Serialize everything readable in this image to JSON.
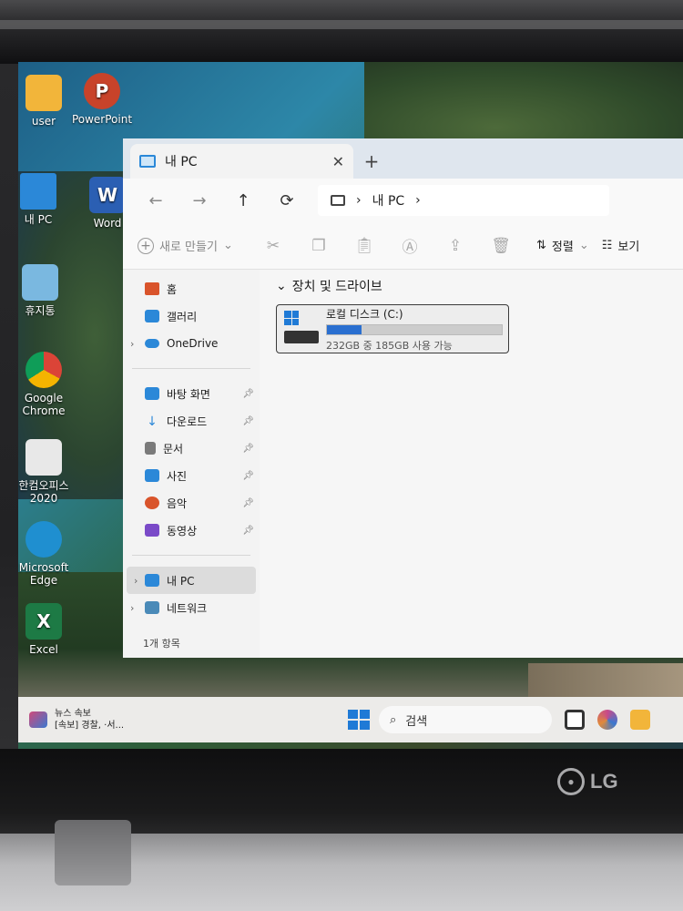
{
  "desktop": {
    "icons": [
      {
        "label": "user",
        "icon": "folder-icon",
        "color": "#f2b53a"
      },
      {
        "label": "PowerPoint",
        "icon": "powerpoint-icon",
        "color": "#c8432a"
      },
      {
        "label": "내 PC",
        "icon": "pc-icon",
        "color": "#2b88d8"
      },
      {
        "label": "Word",
        "icon": "word-icon",
        "color": "#2b5fb3"
      },
      {
        "label": "휴지통",
        "icon": "recycle-bin-icon",
        "color": "#7ab8e0"
      },
      {
        "label": "Google Chrome",
        "icon": "chrome-icon",
        "color": "#db4437"
      },
      {
        "label": "한컴오피스 2020",
        "icon": "hancom-office-icon",
        "color": "#e8e8e8"
      },
      {
        "label": "Microsoft Edge",
        "icon": "edge-icon",
        "color": "#1f8fd0"
      },
      {
        "label": "Excel",
        "icon": "excel-icon",
        "color": "#1d7a45"
      }
    ],
    "glyphs": {
      "powerpoint": "P",
      "word": "W",
      "excel": "X"
    }
  },
  "explorer": {
    "tab_title": "내 PC",
    "tab_close": "✕",
    "new_tab": "+",
    "nav": {
      "back": "←",
      "forward": "→",
      "up": "↑",
      "refresh": "⟳"
    },
    "breadcrumb": {
      "sep": "›",
      "item": "내 PC"
    },
    "toolbar": {
      "new_label": "새로 만들기",
      "sort_label": "정렬",
      "view_label": "보기"
    },
    "sidebar": {
      "home": "홈",
      "gallery": "갤러리",
      "onedrive": "OneDrive",
      "pinned": [
        {
          "label": "바탕 화면",
          "icon": "desktop-icon",
          "color": "#2b88d8"
        },
        {
          "label": "다운로드",
          "icon": "download-icon",
          "color": "#2b88d8"
        },
        {
          "label": "문서",
          "icon": "documents-icon",
          "color": "#7a7a7a"
        },
        {
          "label": "사진",
          "icon": "pictures-icon",
          "color": "#2b88d8"
        },
        {
          "label": "음악",
          "icon": "music-icon",
          "color": "#d9542b"
        },
        {
          "label": "동영상",
          "icon": "videos-icon",
          "color": "#7a4ac8"
        }
      ],
      "this_pc": "내 PC",
      "network": "네트워크"
    },
    "status": "1개 항목",
    "section_title": "장치 및 드라이브",
    "drive": {
      "name": "로컬 디스크 (C:)",
      "free_text": "232GB 중 185GB 사용 가능",
      "used_fraction": 0.2
    }
  },
  "taskbar": {
    "news_title": "뉴스 속보",
    "news_sub": "[속보] 경찰, ·서...",
    "search_placeholder": "검색"
  },
  "brand": "LG"
}
